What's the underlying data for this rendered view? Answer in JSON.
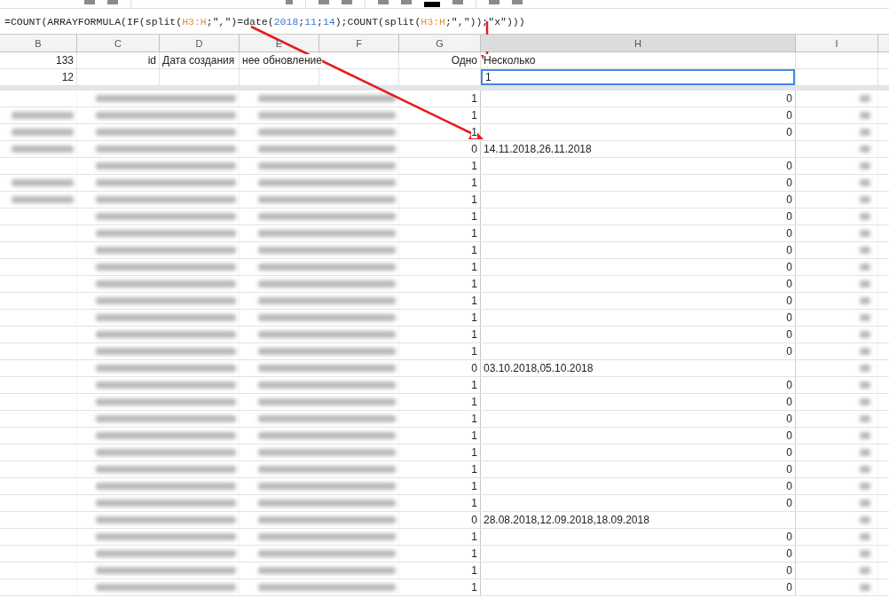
{
  "formula_bar": {
    "tokens": [
      {
        "kind": "plain",
        "text": "=COUNT(ARRAYFORMULA(IF(split("
      },
      {
        "kind": "ref",
        "text": "H3:H"
      },
      {
        "kind": "plain",
        "text": ";\",\")=date("
      },
      {
        "kind": "number",
        "text": "2018"
      },
      {
        "kind": "plain",
        "text": ";"
      },
      {
        "kind": "number",
        "text": "11"
      },
      {
        "kind": "plain",
        "text": ";"
      },
      {
        "kind": "number",
        "text": "14"
      },
      {
        "kind": "plain",
        "text": ");COUNT(split("
      },
      {
        "kind": "ref",
        "text": "H3:H"
      },
      {
        "kind": "plain",
        "text": ";\",\"));\"x\")))"
      }
    ]
  },
  "columns": [
    "B",
    "C",
    "D",
    "E",
    "F",
    "G",
    "H",
    "I"
  ],
  "header_rows": [
    {
      "B": "133",
      "C": "id",
      "D": "Дата создания",
      "E": "нее обновление",
      "G": "Одно",
      "H": "Несколько",
      "selected": false
    },
    {
      "B": "12",
      "H": "1",
      "selected": true
    }
  ],
  "rows": [
    {
      "one": "1",
      "several": "0",
      "kind": "number"
    },
    {
      "one": "1",
      "several": "0",
      "kind": "number"
    },
    {
      "one": "1",
      "several": "0",
      "kind": "number"
    },
    {
      "one": "0",
      "several": "14.11.2018,26.11.2018",
      "kind": "text"
    },
    {
      "one": "1",
      "several": "0",
      "kind": "number"
    },
    {
      "one": "1",
      "several": "0",
      "kind": "number"
    },
    {
      "one": "1",
      "several": "0",
      "kind": "number"
    },
    {
      "one": "1",
      "several": "0",
      "kind": "number"
    },
    {
      "one": "1",
      "several": "0",
      "kind": "number"
    },
    {
      "one": "1",
      "several": "0",
      "kind": "number"
    },
    {
      "one": "1",
      "several": "0",
      "kind": "number"
    },
    {
      "one": "1",
      "several": "0",
      "kind": "number"
    },
    {
      "one": "1",
      "several": "0",
      "kind": "number"
    },
    {
      "one": "1",
      "several": "0",
      "kind": "number"
    },
    {
      "one": "1",
      "several": "0",
      "kind": "number"
    },
    {
      "one": "1",
      "several": "0",
      "kind": "number"
    },
    {
      "one": "0",
      "several": "03.10.2018,05.10.2018",
      "kind": "text"
    },
    {
      "one": "1",
      "several": "0",
      "kind": "number"
    },
    {
      "one": "1",
      "several": "0",
      "kind": "number"
    },
    {
      "one": "1",
      "several": "0",
      "kind": "number"
    },
    {
      "one": "1",
      "several": "0",
      "kind": "number"
    },
    {
      "one": "1",
      "several": "0",
      "kind": "number"
    },
    {
      "one": "1",
      "several": "0",
      "kind": "number"
    },
    {
      "one": "1",
      "several": "0",
      "kind": "number"
    },
    {
      "one": "1",
      "several": "0",
      "kind": "number"
    },
    {
      "one": "0",
      "several": "28.08.2018,12.09.2018,18.09.2018",
      "kind": "text"
    },
    {
      "one": "1",
      "several": "0",
      "kind": "number"
    },
    {
      "one": "1",
      "several": "0",
      "kind": "number"
    },
    {
      "one": "1",
      "several": "0",
      "kind": "number"
    },
    {
      "one": "1",
      "several": "0",
      "kind": "number"
    }
  ]
}
